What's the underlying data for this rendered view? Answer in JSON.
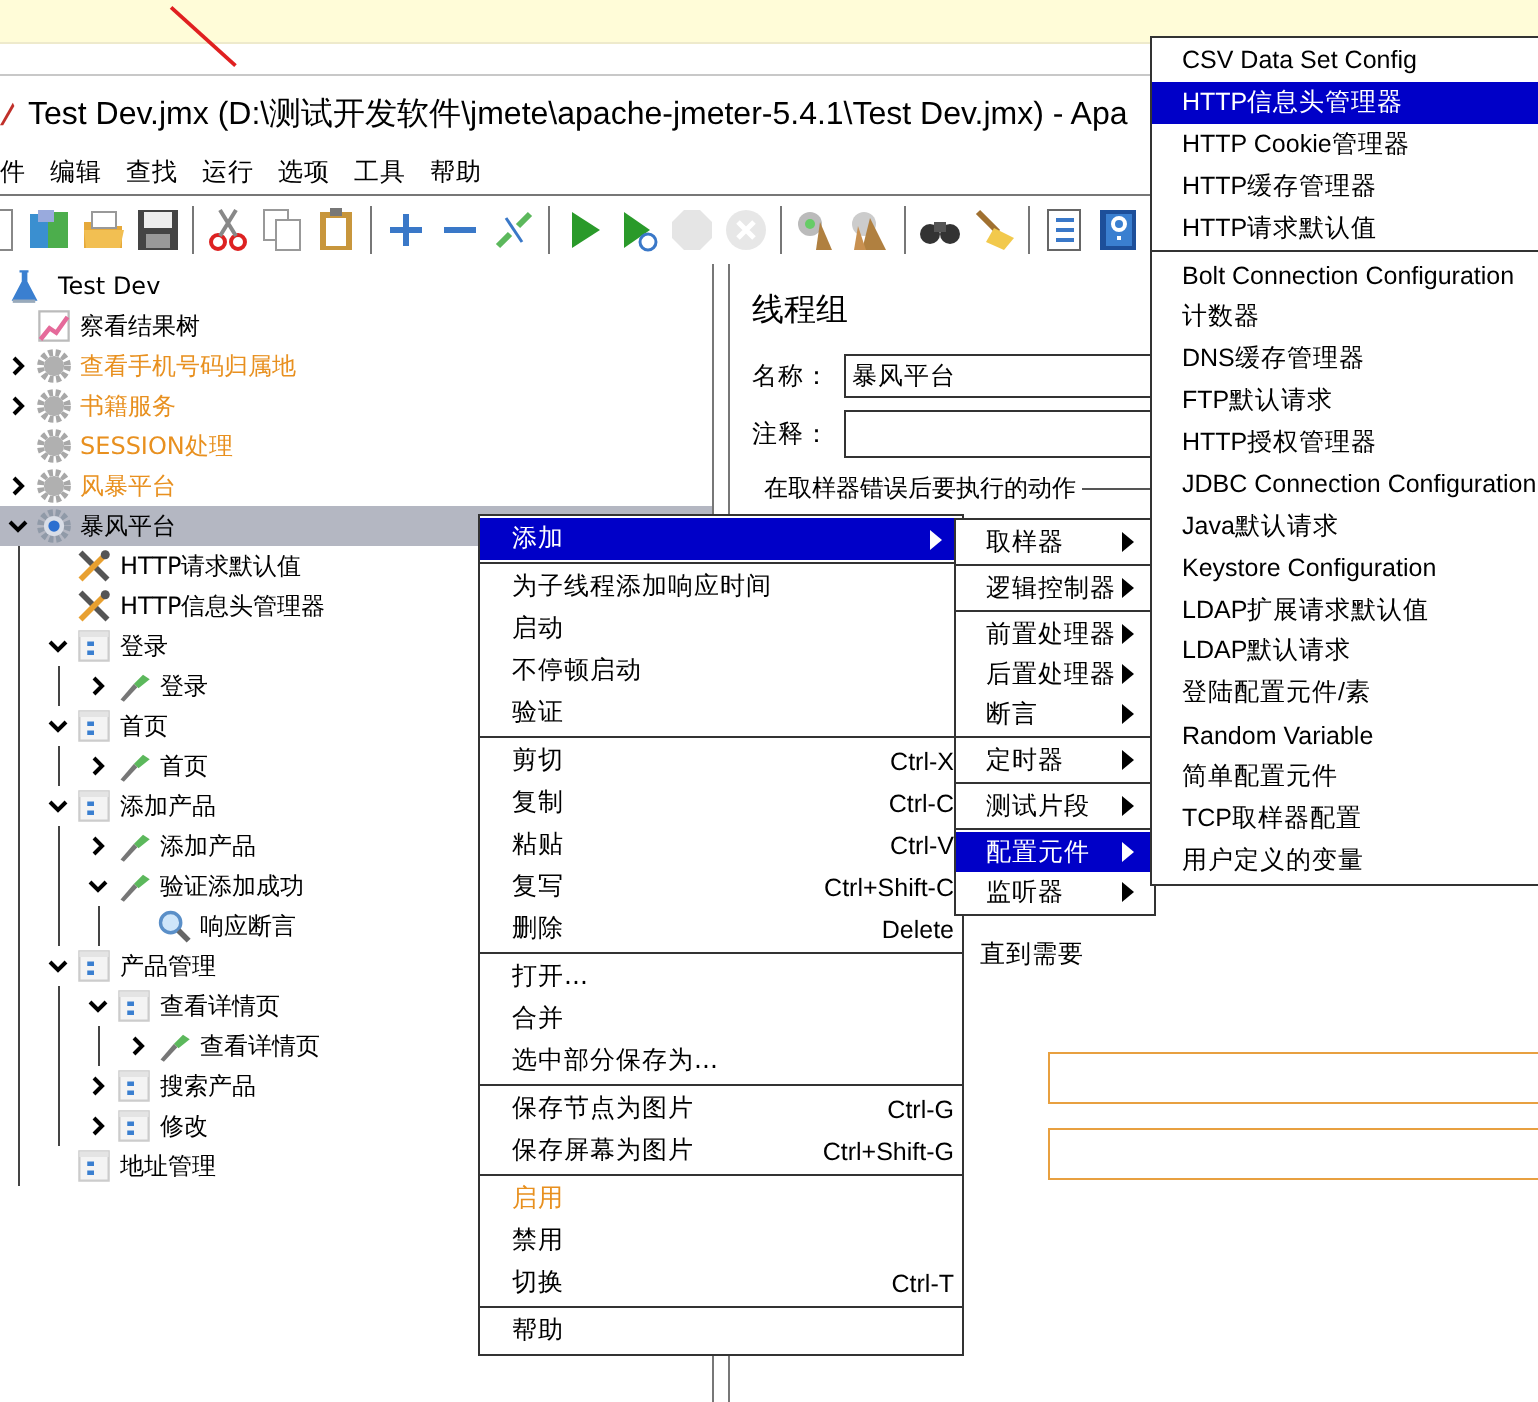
{
  "window": {
    "title": "Test Dev.jmx (D:\\测试开发软件\\jmete\\apache-jmeter-5.4.1\\Test Dev.jmx) - Apa"
  },
  "menubar": [
    "件",
    "编辑",
    "查找",
    "运行",
    "选项",
    "工具",
    "帮助"
  ],
  "toolbar": [
    {
      "kind": "new",
      "disabled": false
    },
    {
      "kind": "templates",
      "disabled": false
    },
    {
      "kind": "open",
      "disabled": false
    },
    {
      "kind": "save",
      "disabled": false
    },
    {
      "kind": "separator"
    },
    {
      "kind": "cut",
      "disabled": false
    },
    {
      "kind": "copy",
      "disabled": false
    },
    {
      "kind": "paste",
      "disabled": false
    },
    {
      "kind": "separator"
    },
    {
      "kind": "expand",
      "disabled": false
    },
    {
      "kind": "collapse",
      "disabled": false
    },
    {
      "kind": "toggle",
      "disabled": false
    },
    {
      "kind": "separator"
    },
    {
      "kind": "start",
      "disabled": false
    },
    {
      "kind": "start-no-pause",
      "disabled": false
    },
    {
      "kind": "stop",
      "disabled": true
    },
    {
      "kind": "shutdown",
      "disabled": true
    },
    {
      "kind": "separator"
    },
    {
      "kind": "clear",
      "disabled": false
    },
    {
      "kind": "clear-all",
      "disabled": false
    },
    {
      "kind": "separator"
    },
    {
      "kind": "search",
      "disabled": false
    },
    {
      "kind": "reset-search",
      "disabled": false
    },
    {
      "kind": "separator"
    },
    {
      "kind": "function-helper",
      "disabled": false
    },
    {
      "kind": "help",
      "disabled": false
    }
  ],
  "tree": {
    "label": "Test Dev",
    "kind": "test-plan",
    "children": [
      {
        "label": "察看结果树",
        "kind": "listener",
        "selected": false,
        "disabled": false
      },
      {
        "label": "查看手机号码归属地",
        "kind": "thread-group",
        "expanded": false,
        "selected": false,
        "disabled": true
      },
      {
        "label": "书籍服务",
        "kind": "thread-group",
        "expanded": false,
        "selected": false,
        "disabled": true
      },
      {
        "label": "SESSION处理",
        "kind": "thread-group",
        "selected": false,
        "disabled": true
      },
      {
        "label": "风暴平台",
        "kind": "thread-group",
        "expanded": false,
        "selected": false,
        "disabled": true
      },
      {
        "label": "暴风平台",
        "kind": "thread-group",
        "expanded": true,
        "selected": true,
        "disabled": false,
        "children": [
          {
            "label": "HTTP请求默认值",
            "kind": "config",
            "selected": false,
            "disabled": false
          },
          {
            "label": "HTTP信息头管理器",
            "kind": "config",
            "selected": false,
            "disabled": false
          },
          {
            "label": "登录",
            "kind": "controller",
            "expanded": true,
            "selected": false,
            "disabled": false,
            "children": [
              {
                "label": "登录",
                "kind": "sampler",
                "expanded": false,
                "selected": false,
                "disabled": false
              }
            ]
          },
          {
            "label": "首页",
            "kind": "controller",
            "expanded": true,
            "selected": false,
            "disabled": false,
            "children": [
              {
                "label": "首页",
                "kind": "sampler",
                "expanded": false,
                "selected": false,
                "disabled": false
              }
            ]
          },
          {
            "label": "添加产品",
            "kind": "controller",
            "expanded": true,
            "selected": false,
            "disabled": false,
            "children": [
              {
                "label": "添加产品",
                "kind": "sampler",
                "expanded": false,
                "selected": false,
                "disabled": false
              },
              {
                "label": "验证添加成功",
                "kind": "sampler",
                "expanded": true,
                "selected": false,
                "disabled": false,
                "children": [
                  {
                    "label": "响应断言",
                    "kind": "assertion",
                    "selected": false,
                    "disabled": false
                  }
                ]
              }
            ]
          },
          {
            "label": "产品管理",
            "kind": "controller",
            "expanded": true,
            "selected": false,
            "disabled": false,
            "children": [
              {
                "label": "查看详情页",
                "kind": "controller",
                "expanded": true,
                "selected": false,
                "disabled": false,
                "children": [
                  {
                    "label": "查看详情页",
                    "kind": "sampler",
                    "expanded": false,
                    "selected": false,
                    "disabled": false
                  }
                ]
              },
              {
                "label": "搜索产品",
                "kind": "controller",
                "expanded": false,
                "selected": false,
                "disabled": false
              },
              {
                "label": "修改",
                "kind": "controller",
                "expanded": false,
                "selected": false,
                "disabled": false
              }
            ]
          },
          {
            "label": "地址管理",
            "kind": "controller",
            "selected": false,
            "disabled": false
          }
        ]
      }
    ]
  },
  "panel": {
    "heading": "线程组",
    "name_label": "名称：",
    "name_value": "暴风平台",
    "comment_label": "注释：",
    "error_action_legend": "在取样器错误后要执行的动作",
    "partial_text": "直到需要"
  },
  "context_menu": {
    "sections": [
      [
        {
          "label": "添加",
          "submenu": true,
          "selected": true,
          "disabled": false
        }
      ],
      [
        {
          "label": "为子线程添加响应时间",
          "selected": false,
          "disabled": false
        },
        {
          "label": "启动",
          "selected": false,
          "disabled": false
        },
        {
          "label": "不停顿启动",
          "selected": false,
          "disabled": false
        },
        {
          "label": "验证",
          "selected": false,
          "disabled": false
        }
      ],
      [
        {
          "label": "剪切",
          "shortcut": "Ctrl-X",
          "selected": false,
          "disabled": false
        },
        {
          "label": "复制",
          "shortcut": "Ctrl-C",
          "selected": false,
          "disabled": false
        },
        {
          "label": "粘贴",
          "shortcut": "Ctrl-V",
          "selected": false,
          "disabled": false
        },
        {
          "label": "复写",
          "shortcut": "Ctrl+Shift-C",
          "selected": false,
          "disabled": false
        },
        {
          "label": "删除",
          "shortcut": "Delete",
          "selected": false,
          "disabled": false
        }
      ],
      [
        {
          "label": "打开...",
          "selected": false,
          "disabled": false
        },
        {
          "label": "合并",
          "selected": false,
          "disabled": false
        },
        {
          "label": "选中部分保存为...",
          "selected": false,
          "disabled": false
        }
      ],
      [
        {
          "label": "保存节点为图片",
          "shortcut": "Ctrl-G",
          "selected": false,
          "disabled": false
        },
        {
          "label": "保存屏幕为图片",
          "shortcut": "Ctrl+Shift-G",
          "selected": false,
          "disabled": false
        }
      ],
      [
        {
          "label": "启用",
          "selected": false,
          "disabled": true
        },
        {
          "label": "禁用",
          "selected": false,
          "disabled": false
        },
        {
          "label": "切换",
          "shortcut": "Ctrl-T",
          "selected": false,
          "disabled": false
        }
      ],
      [
        {
          "label": "帮助",
          "selected": false,
          "disabled": false
        }
      ]
    ]
  },
  "add_submenu": {
    "sections": [
      [
        {
          "label": "取样器",
          "submenu": true,
          "selected": false
        }
      ],
      [
        {
          "label": "逻辑控制器",
          "submenu": true,
          "selected": false
        }
      ],
      [
        {
          "label": "前置处理器",
          "submenu": true,
          "selected": false
        },
        {
          "label": "后置处理器",
          "submenu": true,
          "selected": false
        },
        {
          "label": "断言",
          "submenu": true,
          "selected": false
        }
      ],
      [
        {
          "label": "定时器",
          "submenu": true,
          "selected": false
        }
      ],
      [
        {
          "label": "测试片段",
          "submenu": true,
          "selected": false
        }
      ],
      [
        {
          "label": "配置元件",
          "submenu": true,
          "selected": true
        },
        {
          "label": "监听器",
          "submenu": true,
          "selected": false
        }
      ]
    ]
  },
  "config_submenu": {
    "sections": [
      [
        {
          "label": "CSV Data Set Config",
          "selected": false
        },
        {
          "label": "HTTP信息头管理器",
          "selected": true
        },
        {
          "label": "HTTP Cookie管理器",
          "selected": false
        },
        {
          "label": "HTTP缓存管理器",
          "selected": false
        },
        {
          "label": "HTTP请求默认值",
          "selected": false
        }
      ],
      [
        {
          "label": "Bolt Connection Configuration",
          "selected": false
        },
        {
          "label": "计数器",
          "selected": false
        },
        {
          "label": "DNS缓存管理器",
          "selected": false
        },
        {
          "label": "FTP默认请求",
          "selected": false
        },
        {
          "label": "HTTP授权管理器",
          "selected": false
        },
        {
          "label": "JDBC Connection Configuration",
          "selected": false
        },
        {
          "label": "Java默认请求",
          "selected": false
        },
        {
          "label": "Keystore Configuration",
          "selected": false
        },
        {
          "label": "LDAP扩展请求默认值",
          "selected": false
        },
        {
          "label": "LDAP默认请求",
          "selected": false
        },
        {
          "label": "登陆配置元件/素",
          "selected": false
        },
        {
          "label": "Random Variable",
          "selected": false
        },
        {
          "label": "简单配置元件",
          "selected": false
        },
        {
          "label": "TCP取样器配置",
          "selected": false
        },
        {
          "label": "用户定义的变量",
          "selected": false
        }
      ]
    ]
  }
}
